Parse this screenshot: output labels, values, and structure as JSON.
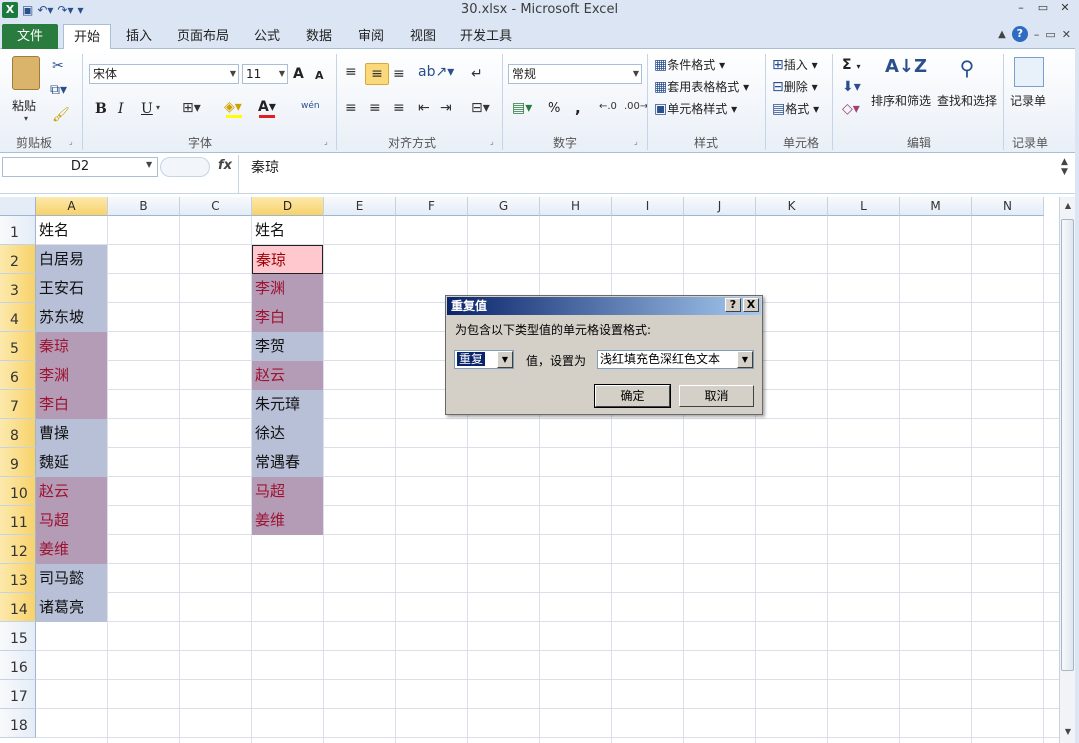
{
  "window": {
    "title": "30.xlsx - Microsoft Excel",
    "controls": [
      "–",
      "▭",
      "✕"
    ]
  },
  "qat": {
    "undo_icon": "undo-icon",
    "redo_icon": "redo-icon",
    "save_icon": "save-icon"
  },
  "tabs": {
    "file": "文件",
    "items": [
      {
        "label": "开始",
        "active": true
      },
      {
        "label": "插入"
      },
      {
        "label": "页面布局"
      },
      {
        "label": "公式"
      },
      {
        "label": "数据"
      },
      {
        "label": "审阅"
      },
      {
        "label": "视图"
      },
      {
        "label": "开发工具"
      }
    ]
  },
  "ribbon": {
    "clipboard": {
      "label": "剪贴板",
      "paste": "粘贴"
    },
    "font": {
      "label": "字体",
      "name": "宋体",
      "size": "11",
      "grow": "A",
      "shrink": "A",
      "bold": "B",
      "italic": "I",
      "underline": "U",
      "phonetic": "wén"
    },
    "align": {
      "label": "对齐方式"
    },
    "number": {
      "label": "数字",
      "format": "常规",
      "percent": "%",
      "comma": ","
    },
    "styles": {
      "label": "样式",
      "cond": "条件格式",
      "table": "套用表格格式",
      "cell": "单元格样式"
    },
    "cells": {
      "label": "单元格",
      "insert": "插入",
      "delete": "删除",
      "format": "格式"
    },
    "edit": {
      "label": "编辑",
      "sum": "Σ",
      "sort": "排序和筛选",
      "find": "查找和选择"
    },
    "record": {
      "label": "记录单",
      "btn": "记录单"
    }
  },
  "formula": {
    "namebox": "D2",
    "fx": "fx",
    "value": "秦琼"
  },
  "columns": [
    "A",
    "B",
    "C",
    "D",
    "E",
    "F",
    "G",
    "H",
    "I",
    "J",
    "K",
    "L",
    "M",
    "N"
  ],
  "rows": [
    "1",
    "2",
    "3",
    "4",
    "5",
    "6",
    "7",
    "8",
    "9",
    "10",
    "11",
    "12",
    "13",
    "14",
    "15",
    "16",
    "17",
    "18"
  ],
  "cells": {
    "A": [
      {
        "text": "姓名",
        "style": "plain"
      },
      {
        "text": "白居易",
        "style": "blue"
      },
      {
        "text": "王安石",
        "style": "blue"
      },
      {
        "text": "苏东坡",
        "style": "blue"
      },
      {
        "text": "秦琼",
        "style": "dup"
      },
      {
        "text": "李渊",
        "style": "dup"
      },
      {
        "text": "李白",
        "style": "dup"
      },
      {
        "text": "曹操",
        "style": "blue"
      },
      {
        "text": "魏延",
        "style": "blue"
      },
      {
        "text": "赵云",
        "style": "dup"
      },
      {
        "text": "马超",
        "style": "dup"
      },
      {
        "text": "姜维",
        "style": "dup"
      },
      {
        "text": "司马懿",
        "style": "blue"
      },
      {
        "text": "诸葛亮",
        "style": "blue"
      }
    ],
    "D": [
      {
        "text": "姓名",
        "style": "plain"
      },
      {
        "text": "秦琼",
        "style": "lightred"
      },
      {
        "text": "李渊",
        "style": "dup"
      },
      {
        "text": "李白",
        "style": "dup"
      },
      {
        "text": "李贺",
        "style": "blue"
      },
      {
        "text": "赵云",
        "style": "dup"
      },
      {
        "text": "朱元璋",
        "style": "blue"
      },
      {
        "text": "徐达",
        "style": "blue"
      },
      {
        "text": "常遇春",
        "style": "blue"
      },
      {
        "text": "马超",
        "style": "dup"
      },
      {
        "text": "姜维",
        "style": "dup"
      }
    ]
  },
  "colors": {
    "blue_fill": "#b8c0d8",
    "dup_fill": "#b49bb6",
    "dup_text": "#9c1431",
    "lightred_fill": "#ffc7ce"
  },
  "dialog": {
    "title": "重复值",
    "help": "?",
    "close": "X",
    "prompt": "为包含以下类型值的单元格设置格式:",
    "type_value": "重复",
    "mid_label": "值，设置为",
    "format_value": "浅红填充色深红色文本",
    "ok": "确定",
    "cancel": "取消"
  }
}
